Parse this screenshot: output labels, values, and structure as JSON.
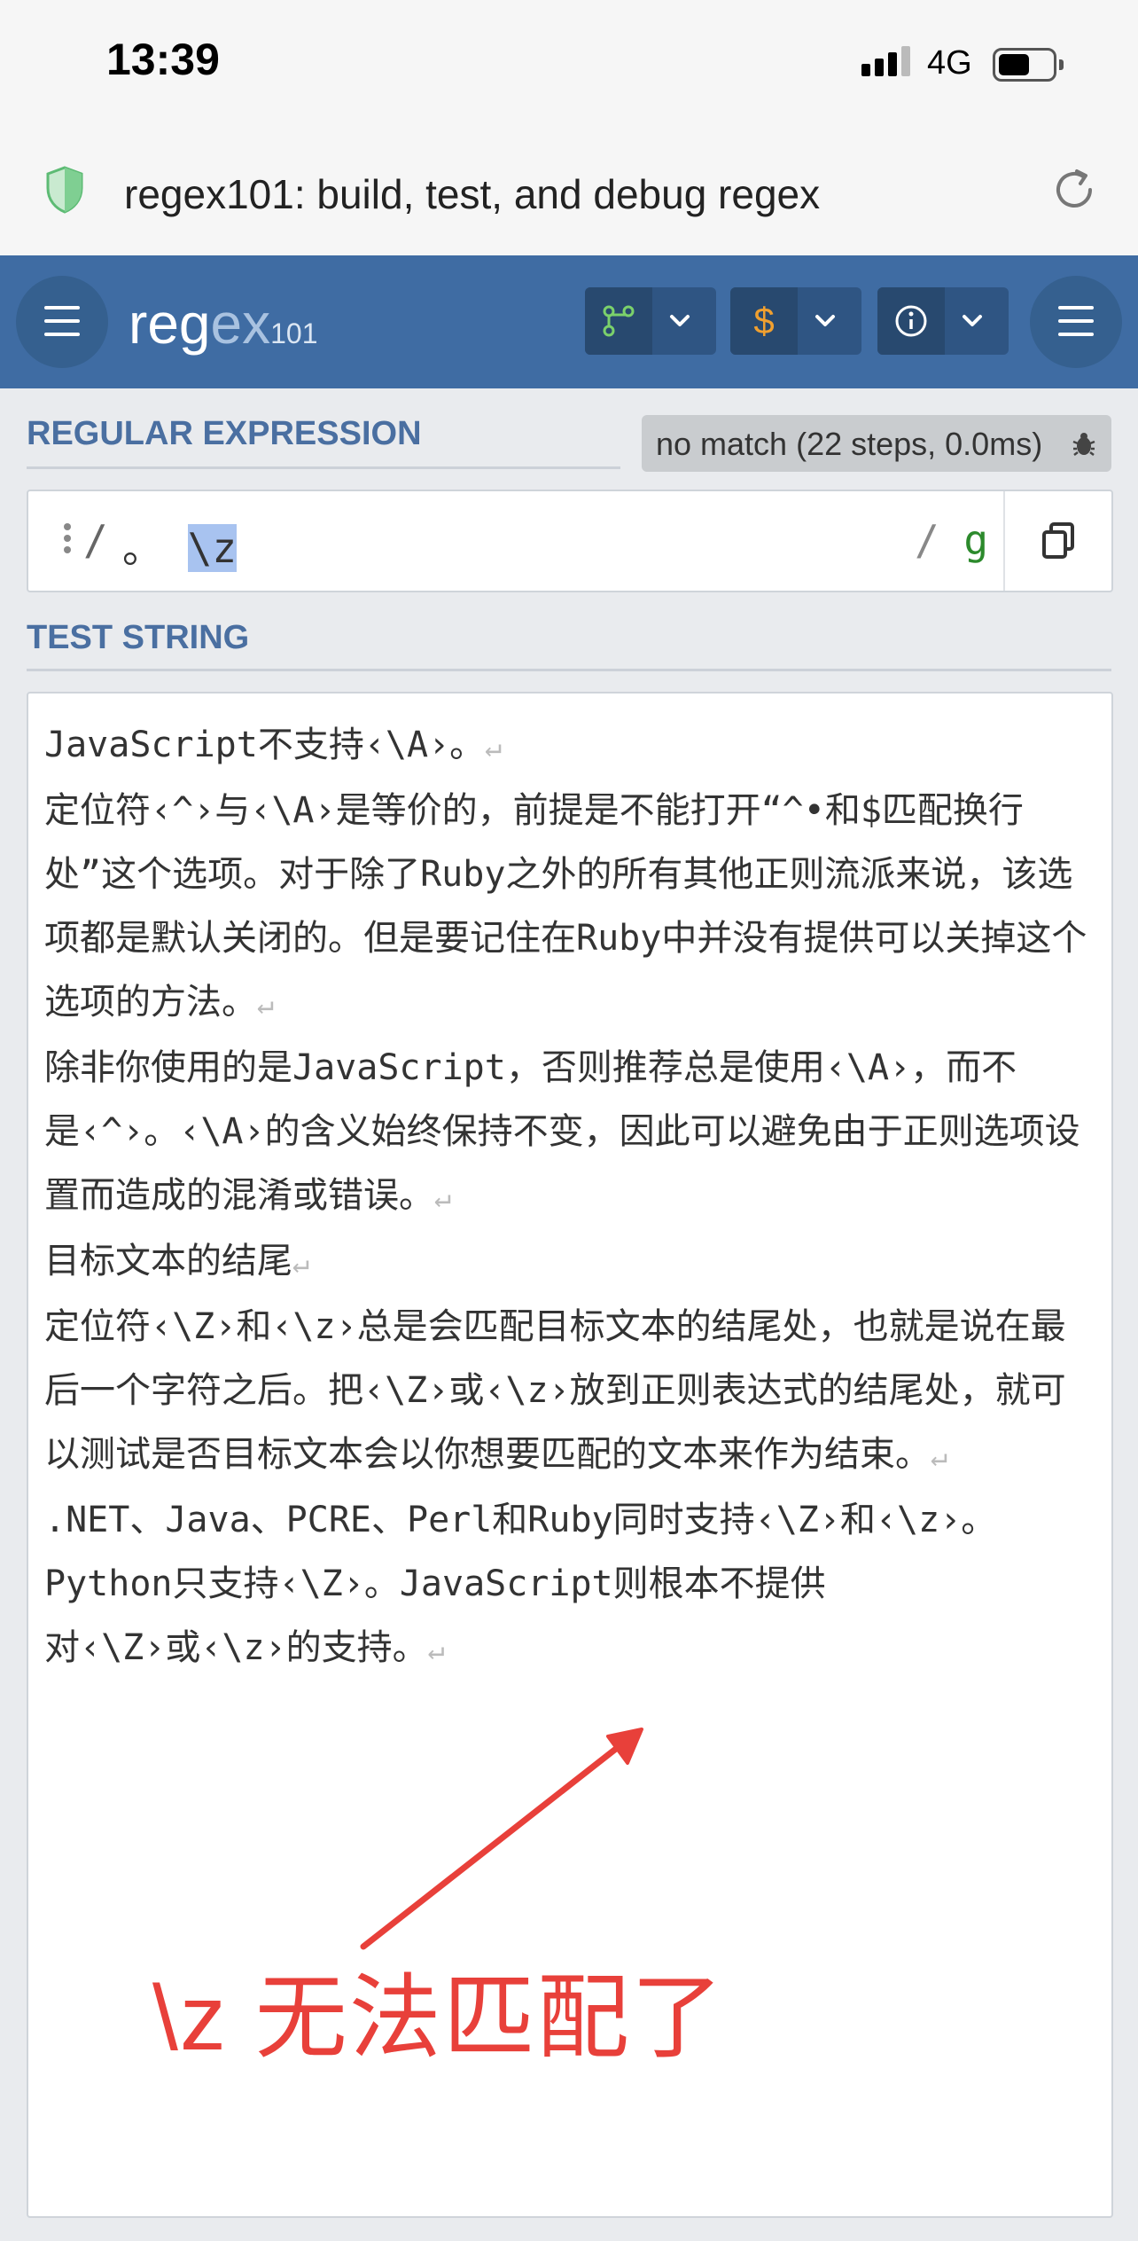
{
  "status_bar": {
    "time": "13:39",
    "network": "4G"
  },
  "browser": {
    "page_title": "regex101: build, test, and debug regex"
  },
  "header": {
    "logo_main": "reg",
    "logo_ex": "ex",
    "logo_sub": "101",
    "groups": [
      {
        "icon": "flavor-branch-icon",
        "color": "#7bd16b"
      },
      {
        "icon": "dollar-icon",
        "text": "$",
        "color": "#f0a030"
      },
      {
        "icon": "info-icon",
        "color": "#ffffff"
      }
    ]
  },
  "regex": {
    "section_label": "REGULAR EXPRESSION",
    "match_info": "no match (22 steps, 0.0ms)",
    "delimiter_open": "/",
    "pattern_plain": "。",
    "pattern_selected": "\\z",
    "delimiter_close": "/",
    "flags": "g"
  },
  "test_string": {
    "section_label": "TEST STRING",
    "lines": [
      "JavaScript不支持‹\\A›。",
      "定位符‹^›与‹\\A›是等价的，前提是不能打开“^•和$匹配换行处”这个选项。对于除了Ruby之外的所有其他正则流派来说，该选项都是默认关闭的。但是要记住在Ruby中并没有提供可以关掉这个选项的方法。",
      "除非你使用的是JavaScript，否则推荐总是使用‹\\A›，而不是‹^›。‹\\A›的含义始终保持不变，因此可以避免由于正则选项设置而造成的混淆或错误。",
      "目标文本的结尾",
      "定位符‹\\Z›和‹\\z›总是会匹配目标文本的结尾处，也就是说在最后一个字符之后。把‹\\Z›或‹\\z›放到正则表达式的结尾处，就可以测试是否目标文本会以你想要匹配的文本来作为结束。",
      ".NET、Java、PCRE、Perl和Ruby同时支持‹\\Z›和‹\\z›。Python只支持‹\\Z›。JavaScript则根本不提供对‹\\Z›或‹\\z›的支持。"
    ],
    "return_glyph": "↵"
  },
  "annotation": {
    "text": "\\z 无法匹配了",
    "color": "#e8403a"
  }
}
